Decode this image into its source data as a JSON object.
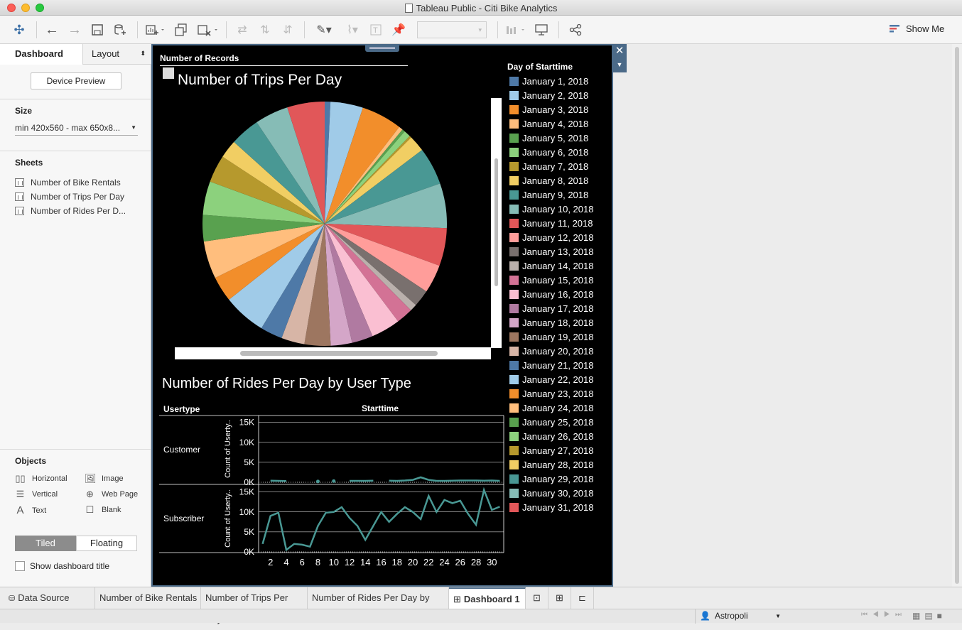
{
  "window": {
    "title": "Tableau Public - Citi Bike Analytics"
  },
  "toolbar": {
    "show_me": "Show Me"
  },
  "left_panel": {
    "tabs": [
      "Dashboard",
      "Layout"
    ],
    "device_preview": "Device Preview",
    "size_title": "Size",
    "size_value": "min 420x560 - max 650x8...",
    "sheets_title": "Sheets",
    "sheets": [
      "Number of Bike Rentals",
      "Number of Trips Per Day",
      "Number of Rides Per D..."
    ],
    "objects_title": "Objects",
    "objects": [
      {
        "label": "Horizontal",
        "icon": "horizontal-icon"
      },
      {
        "label": "Image",
        "icon": "image-icon"
      },
      {
        "label": "Vertical",
        "icon": "vertical-icon"
      },
      {
        "label": "Web Page",
        "icon": "globe-icon"
      },
      {
        "label": "Text",
        "icon": "text-icon"
      },
      {
        "label": "Blank",
        "icon": "blank-icon"
      }
    ],
    "tiled": "Tiled",
    "floating": "Floating",
    "show_title": "Show dashboard title"
  },
  "dashboard": {
    "records_label": "Number of Records",
    "pie_title": "Number of Trips Per Day",
    "line_title": "Number of Rides Per Day by User Type",
    "usertype_header": "Usertype",
    "starttime_header": "Starttime",
    "row_labels": [
      "Customer",
      "Subscriber"
    ],
    "y_axis_label": "Count of Userty..",
    "legend_title": "Day of Starttime"
  },
  "colors": [
    "#4e79a7",
    "#a0cbe8",
    "#f28e2b",
    "#ffbe7d",
    "#59a14f",
    "#8cd17d",
    "#b6992d",
    "#f1ce63",
    "#499894",
    "#86bcb6",
    "#e15759",
    "#ff9d9a",
    "#79706e",
    "#bab0ac",
    "#d37295",
    "#fabfd2",
    "#b07aa1",
    "#d4a6c8",
    "#9d7660",
    "#d7b5a6"
  ],
  "chart_data": [
    {
      "type": "pie",
      "title": "Number of Trips Per Day",
      "legend_title": "Day of Starttime",
      "categories": [
        "January 1, 2018",
        "January 2, 2018",
        "January 3, 2018",
        "January 4, 2018",
        "January 5, 2018",
        "January 6, 2018",
        "January 7, 2018",
        "January 8, 2018",
        "January 9, 2018",
        "January 10, 2018",
        "January 11, 2018",
        "January 12, 2018",
        "January 13, 2018",
        "January 14, 2018",
        "January 15, 2018",
        "January 16, 2018",
        "January 17, 2018",
        "January 18, 2018",
        "January 19, 2018",
        "January 20, 2018",
        "January 21, 2018",
        "January 22, 2018",
        "January 23, 2018",
        "January 24, 2018",
        "January 25, 2018",
        "January 26, 2018",
        "January 27, 2018",
        "January 28, 2018",
        "January 29, 2018",
        "January 30, 2018",
        "January 31, 2018"
      ],
      "values": [
        2.8,
        16,
        20,
        2,
        1.4,
        3.3,
        1,
        8,
        18.5,
        22,
        18.6,
        14,
        8.3,
        3.5,
        8.2,
        14.3,
        10.4,
        10.5,
        12.8,
        11.4,
        10.9,
        21,
        12.5,
        18.5,
        13,
        16.5,
        13.5,
        9,
        14.6,
        16.5,
        18.4
      ],
      "legend_position": "right"
    },
    {
      "type": "line",
      "title": "Number of Rides Per Day by User Type",
      "xlabel": "Starttime",
      "ylabel": "Count of Userty..",
      "x": [
        1,
        2,
        3,
        4,
        5,
        6,
        7,
        8,
        9,
        10,
        11,
        12,
        13,
        14,
        15,
        16,
        17,
        18,
        19,
        20,
        21,
        22,
        23,
        24,
        25,
        26,
        27,
        28,
        29,
        30,
        31
      ],
      "x_ticks": [
        2,
        4,
        6,
        8,
        10,
        12,
        14,
        16,
        18,
        20,
        22,
        24,
        26,
        28,
        30
      ],
      "y_ticks": [
        "0K",
        "5K",
        "10K",
        "15K"
      ],
      "ylim": [
        0,
        16000
      ],
      "series": [
        {
          "name": "Customer",
          "values": [
            null,
            400,
            350,
            300,
            null,
            null,
            null,
            200,
            null,
            300,
            null,
            350,
            350,
            350,
            400,
            null,
            400,
            350,
            450,
            600,
            1250,
            600,
            350,
            350,
            400,
            450,
            450,
            450,
            400,
            450,
            350
          ]
        },
        {
          "name": "Subscriber",
          "values": [
            2000,
            9000,
            9800,
            500,
            2000,
            1800,
            1300,
            6500,
            9800,
            10000,
            11200,
            8500,
            6500,
            3000,
            6500,
            10000,
            7500,
            9500,
            11200,
            10000,
            8200,
            14000,
            10000,
            13000,
            12200,
            12800,
            9500,
            6800,
            15500,
            10500,
            11300
          ]
        }
      ]
    }
  ],
  "bottom": {
    "tabs": [
      "Data Source",
      "Number of Bike Rentals",
      "Number of Trips Per Day",
      "Number of Rides Per Day by Use...",
      "Dashboard 1"
    ],
    "user": "Astropoli"
  }
}
